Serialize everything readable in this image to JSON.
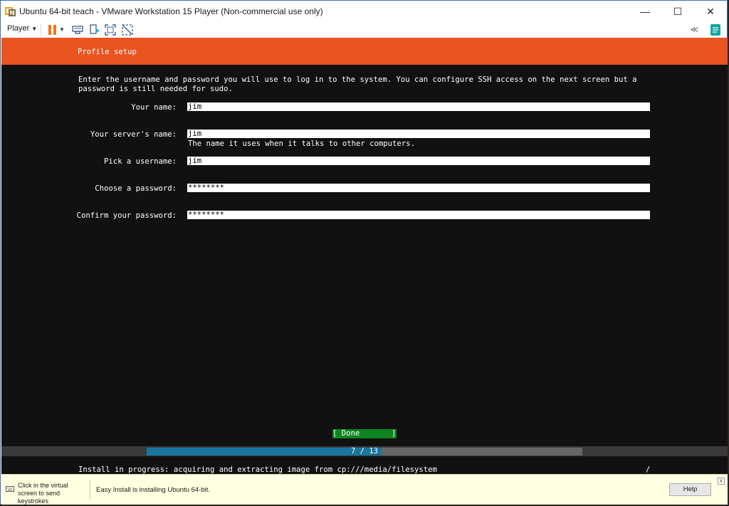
{
  "window": {
    "title": "Ubuntu 64-bit teach - VMware Workstation 15 Player (Non-commercial use only)",
    "minimize_glyph": "—",
    "maximize_glyph": "☐",
    "close_glyph": "✕"
  },
  "toolbar": {
    "player_label": "Player",
    "collapse_glyph": "≪"
  },
  "installer": {
    "header": "Profile setup",
    "intro_line1": "Enter the username and password you will use to log in to the system. You can configure SSH access on the next screen but a",
    "intro_line2": "password is still needed for sudo.",
    "fields": [
      {
        "label": "Your name:",
        "value": "jim"
      },
      {
        "label": "Your server's name:",
        "value": "jim",
        "help": "The name it uses when it talks to other computers."
      },
      {
        "label": "Pick a username:",
        "value": "jim"
      },
      {
        "label": "Choose a password:",
        "value": "********"
      },
      {
        "label": "Confirm your password:",
        "value": "********"
      }
    ],
    "done_button": "[ Done       ]",
    "progress": {
      "text": "7 / 13",
      "current": 7,
      "total": 13
    },
    "status": "Install in progress: acquiring and extracting image from cp:///media/filesystem",
    "spinner": "/"
  },
  "infobar": {
    "hint": "Click in the virtual screen to send keystrokes",
    "message": "Easy Install is installing Ubuntu 64-bit.",
    "help_label": "Help",
    "close_glyph": "x"
  },
  "colors": {
    "ubuntu_orange": "#e95420",
    "done_green": "#0e8420",
    "progress_blue": "#19759c",
    "info_bar_bg": "#ffffe1"
  }
}
